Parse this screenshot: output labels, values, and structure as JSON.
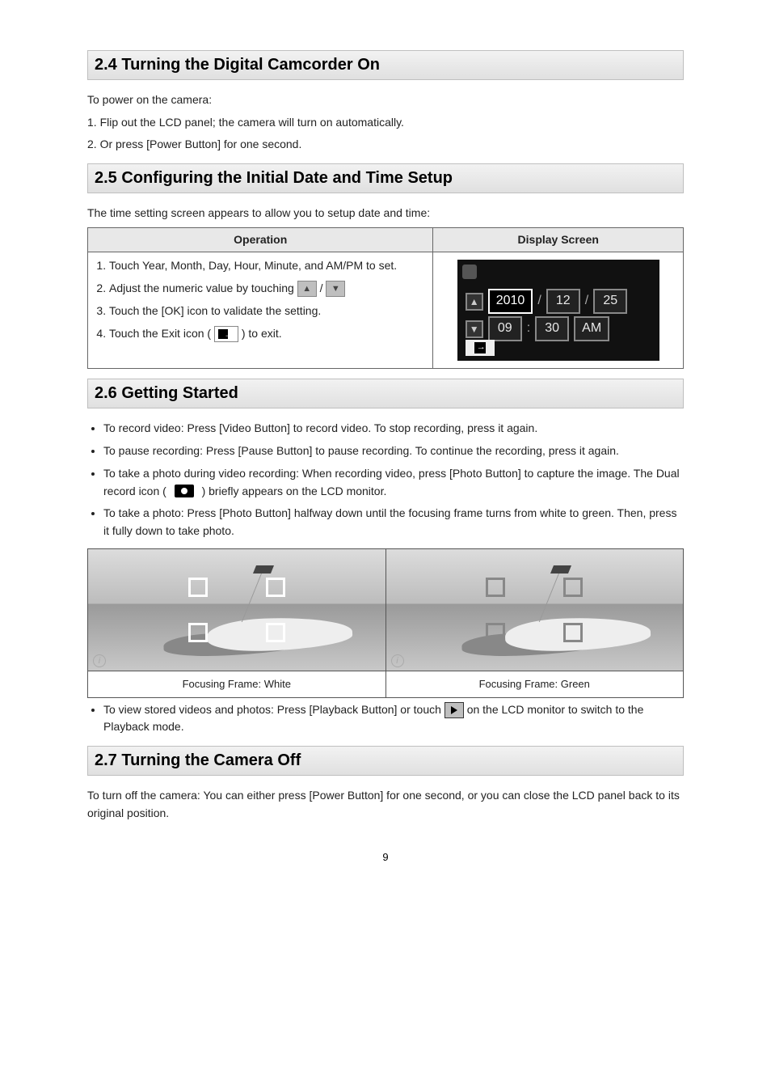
{
  "sections": {
    "s24": {
      "title": "2.4 Turning the Digital Camcorder On"
    },
    "s25": {
      "title": "2.5 Configuring the Initial Date and Time Setup"
    },
    "s26": {
      "title": "2.6 Getting Started"
    },
    "s27": {
      "title": "2.7 Turning the Camera Off"
    }
  },
  "s24": {
    "intro": "To power on the camera:",
    "line1": "1. Flip out the LCD panel; the camera will turn on automatically.",
    "line2": "2. Or press [Power Button] for one second."
  },
  "s25": {
    "intro": "The time setting screen appears to allow you to setup date and time:",
    "headers": {
      "op": "Operation",
      "screen": "Display Screen"
    },
    "steps": {
      "l1": "Touch Year, Month, Day, Hour, Minute, and AM/PM to set.",
      "l2a": "Adjust the numeric value by touching ",
      "l2b": " / ",
      "l3": "Touch the [OK] icon to validate the setting.",
      "l4a": "Touch the Exit icon ( ",
      "l4b": " ) to exit."
    },
    "lcd": {
      "year": "2010",
      "month": "12",
      "day": "25",
      "hour": "09",
      "min": "30",
      "ampm": "AM",
      "sep_date": "/",
      "sep_time": ":"
    }
  },
  "s26": {
    "b1": "To record video: Press [Video Button] to record video. To stop recording, press it again.",
    "b2": "To pause recording: Press [Pause Button] to pause recording. To continue the recording, press it again.",
    "b3a": "To take a photo during video recording: When recording video, press [Photo Button] to capture the image. The Dual record icon ( ",
    "b3b": " ) briefly appears on the LCD monitor.",
    "b4": "To take a photo: Press [Photo Button] halfway down until the focusing frame turns from white to green. Then, press it fully down to take photo.",
    "cap_white": "Focusing Frame: White",
    "cap_green": "Focusing Frame: Green",
    "b5a": "To view stored videos and photos: Press [Playback Button] or touch ",
    "b5b": " on the LCD monitor to switch to the Playback mode."
  },
  "s27": {
    "body": "To turn off the camera: You can either press [Power Button] for one second, or you can close the LCD panel back to its original position."
  },
  "page_number": "9"
}
